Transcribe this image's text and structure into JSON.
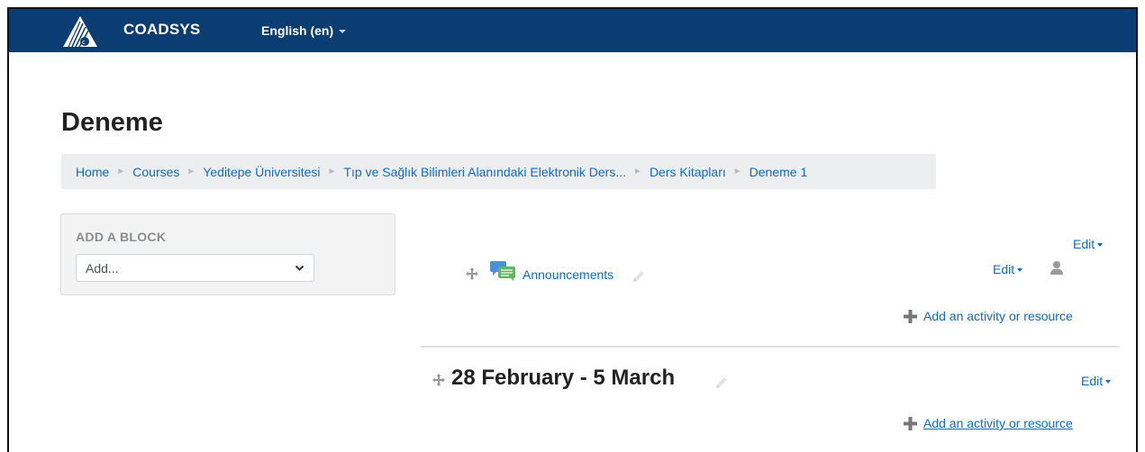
{
  "navbar": {
    "brand": "COADSYS",
    "language": "English (en)",
    "bg_color": "#0b3d73"
  },
  "page": {
    "title": "Deneme"
  },
  "breadcrumb": {
    "items": [
      "Home",
      "Courses",
      "Yeditepe Üniversitesi",
      "Tıp ve Sağlık Bilimleri Alanındaki Elektronik Ders...",
      "Ders Kitapları",
      "Deneme 1"
    ]
  },
  "add_block": {
    "title": "ADD A BLOCK",
    "select_value": "Add..."
  },
  "section0": {
    "edit_label": "Edit",
    "activity": {
      "name": "Announcements",
      "icon": "forum-icon",
      "edit_label": "Edit"
    },
    "add_resource": "Add an activity or resource"
  },
  "section1": {
    "title": "28 February - 5 March",
    "edit_label": "Edit",
    "add_resource": "Add an activity or resource"
  },
  "colors": {
    "link": "#0f6cbf",
    "breadcrumb_bg": "#eceeef"
  }
}
